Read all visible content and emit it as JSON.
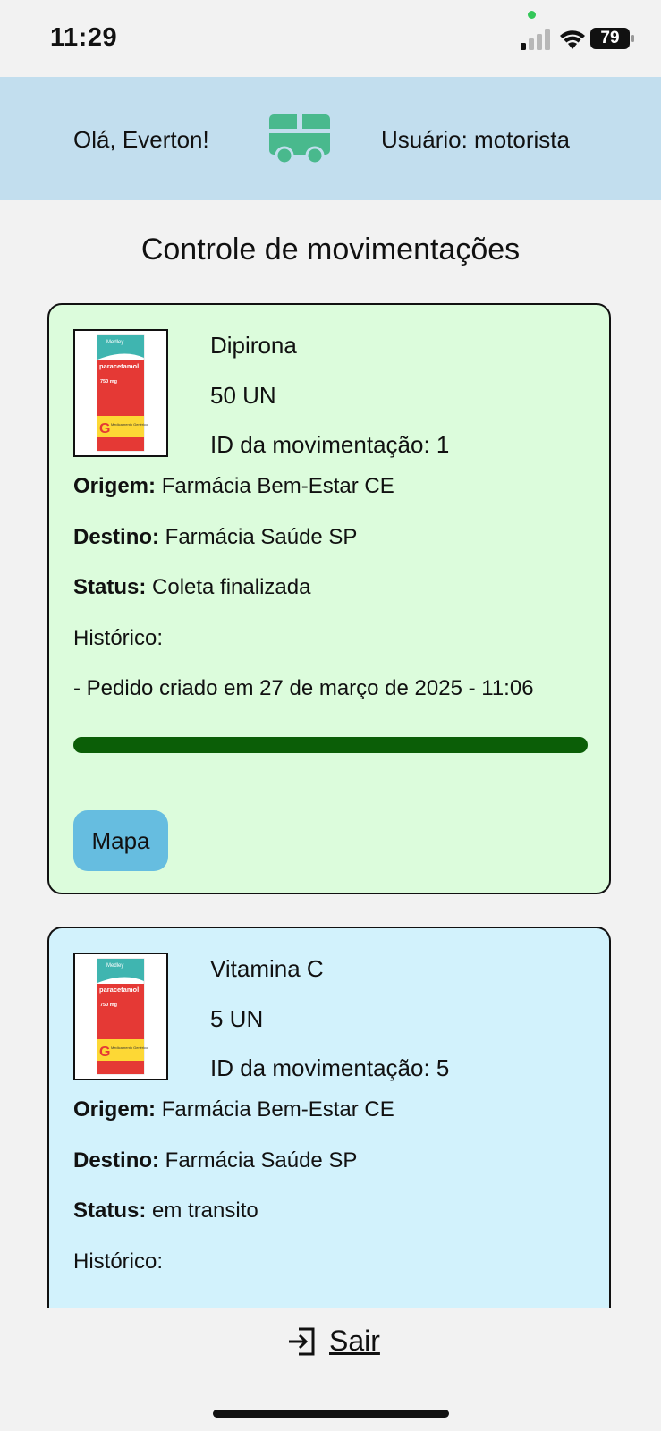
{
  "status_bar": {
    "time": "11:29",
    "battery": "79"
  },
  "header": {
    "greeting": "Olá, Everton!",
    "user_label": "Usuário: motorista",
    "logo_icon": "truck-icon",
    "background": "#c2deee"
  },
  "page_title": "Controle de movimentações",
  "thumbnail_text": {
    "brand": "Medley",
    "product": "paracetamol",
    "dose": "750 mg",
    "badge": "G",
    "badge_text": "Medicamento Genérico"
  },
  "cards": [
    {
      "product": "Dipirona",
      "quantity": "50 UN",
      "movement_id": "ID da movimentação: 1",
      "origin_label": "Origem:",
      "origin": "Farmácia Bem-Estar CE",
      "destination_label": "Destino:",
      "destination": "Farmácia Saúde SP",
      "status_label": "Status:",
      "status": "Coleta finalizada",
      "history_label": "Histórico:",
      "history": [
        "- Pedido criado em 27 de março de 2025 - 11:06"
      ],
      "progress": 1.0,
      "map_button": "Mapa",
      "background": "#dcfcdc"
    },
    {
      "product": "Vitamina C",
      "quantity": "5 UN",
      "movement_id": "ID da movimentação: 5",
      "origin_label": "Origem:",
      "origin": "Farmácia Bem-Estar CE",
      "destination_label": "Destino:",
      "destination": "Farmácia Saúde SP",
      "status_label": "Status:",
      "status": "em transito",
      "history_label": "Histórico:",
      "background": "#d2f2fc"
    }
  ],
  "footer": {
    "logout_label": "Sair",
    "logout_icon": "logout-icon"
  }
}
